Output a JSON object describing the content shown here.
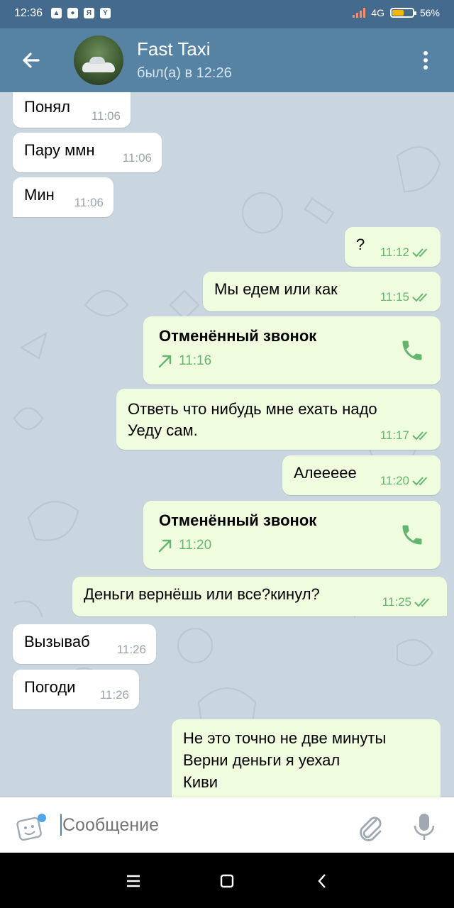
{
  "status_bar": {
    "time": "12:36",
    "network": "4G",
    "battery": "56%",
    "battery_level": 0.56,
    "notification_icons": [
      "taxi-app-icon",
      "whatsapp-icon",
      "yandex-icon",
      "yandex-browser-icon"
    ]
  },
  "header": {
    "title": "Fast Taxi",
    "subtitle": "был(а) в 12:26"
  },
  "messages": [
    {
      "dir": "in",
      "text": "Понял",
      "time": "11:06"
    },
    {
      "dir": "in",
      "text": "Пару ммн",
      "time": "11:06"
    },
    {
      "dir": "in",
      "text": "Мин",
      "time": "11:06"
    },
    {
      "dir": "out",
      "text": "?",
      "time": "11:12"
    },
    {
      "dir": "out",
      "text": "Мы едем или как",
      "time": "11:15"
    },
    {
      "dir": "out",
      "type": "call",
      "title": "Отменённый звонок",
      "time": "11:16"
    },
    {
      "dir": "out",
      "lines": [
        "Ответь что нибудь мне ехать надо",
        "Уеду сам."
      ],
      "time": "11:17"
    },
    {
      "dir": "out",
      "text": "Алеееее",
      "time": "11:20"
    },
    {
      "dir": "out",
      "type": "call",
      "title": "Отменённый звонок",
      "time": "11:20"
    },
    {
      "dir": "out",
      "text": "Деньги вернёшь или все?кинул?",
      "time": "11:25"
    },
    {
      "dir": "in",
      "text": "Вызываб",
      "time": "11:26"
    },
    {
      "dir": "in",
      "text": "Погоди",
      "time": "11:26"
    },
    {
      "dir": "out",
      "lines": [
        "Не это точно не две минуты",
        "Верни деньги я уехал",
        "Киви"
      ]
    }
  ],
  "input": {
    "placeholder": "Сообщение"
  },
  "colors": {
    "header": "#5682a3",
    "status_bar": "#446a8e",
    "outgoing_bubble": "#effdde",
    "incoming_bubble": "#ffffff",
    "accent_green": "#64b66f",
    "chat_background": "#c9d6df"
  }
}
